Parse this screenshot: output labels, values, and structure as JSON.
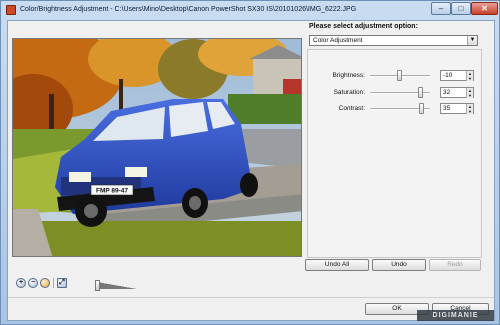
{
  "window": {
    "title": "Color/Brightness Adjustment - C:\\Users\\Mino\\Desktop\\Canon PowerShot SX30 IS\\20101026\\IMG_6222.JPG",
    "controls": {
      "minimize": "–",
      "maximize": "□",
      "close": "✕"
    }
  },
  "panel": {
    "prompt": "Please select adjustment option:",
    "selected_option": "Color Adjustment",
    "adjustments": [
      {
        "label": "Brightness:",
        "value": "-10"
      },
      {
        "label": "Saturation:",
        "value": "32"
      },
      {
        "label": "Contrast:",
        "value": "35"
      }
    ],
    "undo_all": "Undo All",
    "undo": "Undo",
    "redo": "Redo"
  },
  "photo": {
    "license_plate": "FMP 89-47"
  },
  "footer": {
    "ok": "OK",
    "cancel": "Cancel",
    "watermark": "DIGIMANIE"
  },
  "zoom_tools": [
    "zoom-in-icon",
    "zoom-out-icon",
    "hand-icon",
    "fit-icon"
  ]
}
